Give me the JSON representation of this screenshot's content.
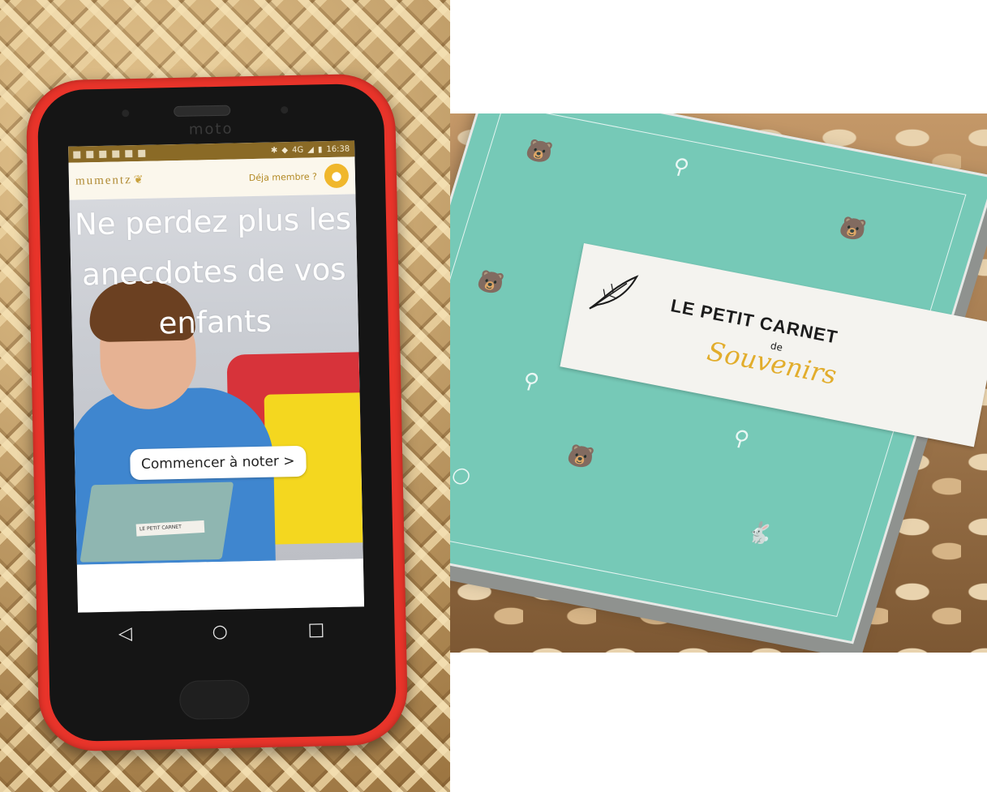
{
  "phone_photo": {
    "phone_brand": "moto",
    "status_bar": {
      "network": "4G",
      "time": "16:38"
    },
    "app": {
      "logo": "mumentz",
      "member_link": "Déja membre ?",
      "hero_title": "Ne perdez plus les anecdotes de vos enfants",
      "cta_label": "Commencer à noter >",
      "book_in_photo": "LE PETIT CARNET"
    },
    "nav_buttons": [
      "◁",
      "○",
      "□"
    ]
  },
  "book_photo": {
    "title_line1": "LE PETIT CARNET",
    "title_de": "de",
    "title_line2": "Souvenirs"
  },
  "colors": {
    "phone_case": "#e8342a",
    "app_accent": "#f0b72c",
    "book_cover": "#76c9b7",
    "title_script": "#e2ad2c"
  },
  "icons": {
    "avatar": "user-icon",
    "logo_mark": "feather-icon",
    "nav": [
      "back-icon",
      "home-icon",
      "recents-icon"
    ]
  }
}
